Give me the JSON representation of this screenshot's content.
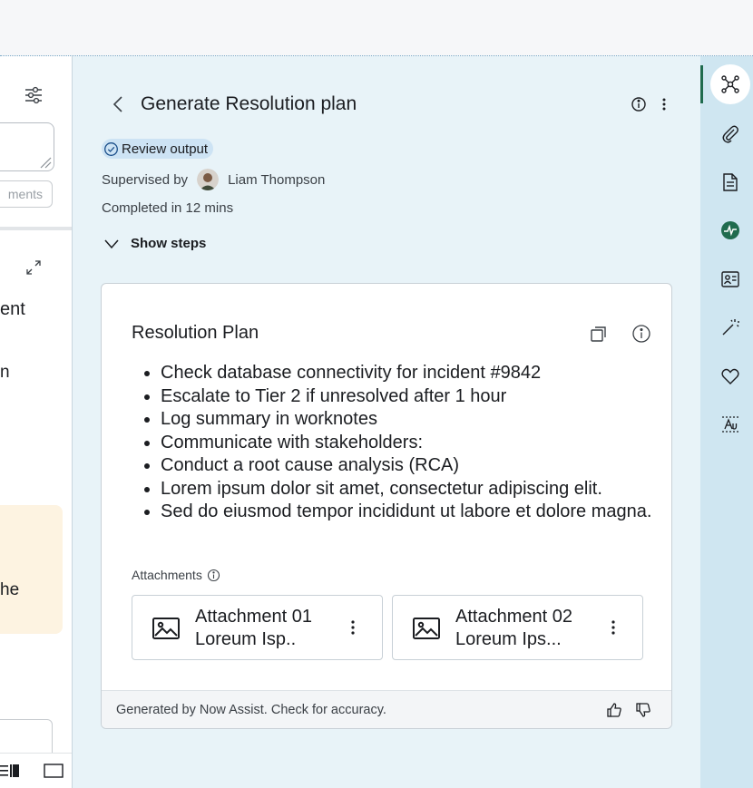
{
  "left_panel": {
    "button_label": "ments",
    "text_line1": "ent",
    "text_line2": "n",
    "text_line3": "he"
  },
  "header": {
    "title": "Generate Resolution plan"
  },
  "status": {
    "badge": "Review output",
    "supervised_label": "Supervised by",
    "supervisor_name": "Liam Thompson",
    "completed": "Completed in 12 mins",
    "show_steps": "Show steps"
  },
  "card": {
    "title": "Resolution Plan",
    "items": [
      "Check database connectivity for incident #9842",
      "Escalate to Tier 2 if unresolved after 1 hour",
      "Log summary in worknotes",
      "Communicate with stakeholders:",
      "Conduct a root cause analysis (RCA)",
      "Lorem ipsum dolor sit amet, consectetur adipiscing elit.",
      "Sed do eiusmod tempor incididunt ut labore et dolore magna."
    ],
    "attachments_label": "Attachments",
    "attachments": [
      {
        "name": "Attachment 01",
        "sub": "Loreum Isp.."
      },
      {
        "name": "Attachment 02",
        "sub": "Loreum Ips..."
      }
    ],
    "footer": "Generated by Now Assist. Check for accuracy."
  },
  "colors": {
    "accent_green": "#1f6b4e",
    "badge_blue": "#cde3f4",
    "rail_bg": "#cfe6f1",
    "main_bg": "#e8f3f8",
    "warn_bg": "#fdf3e1"
  },
  "rail_icons": [
    "network-icon",
    "paperclip-icon",
    "document-icon",
    "activity-icon",
    "contact-card-icon",
    "magic-wand-icon",
    "heart-icon",
    "translate-icon"
  ]
}
